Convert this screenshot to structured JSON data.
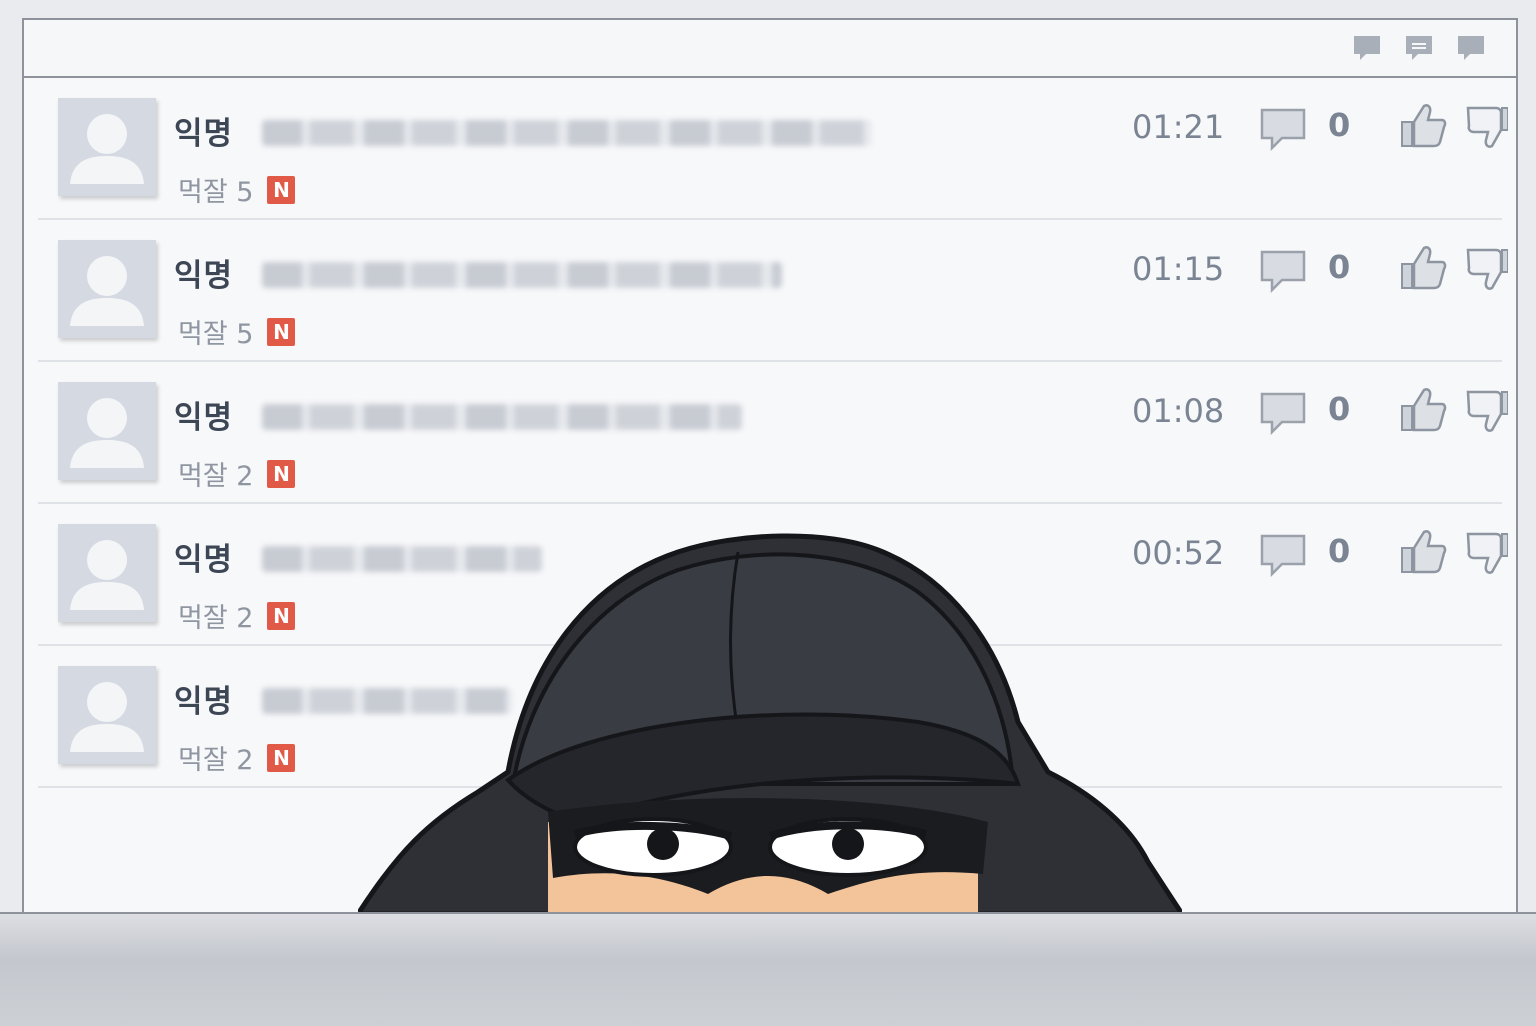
{
  "toolbar": {
    "icons": [
      "comment-icon",
      "expand-icon",
      "comment-icon"
    ]
  },
  "posts": [
    {
      "author": "익명",
      "category": "먹잘",
      "count": "5",
      "badge": "N",
      "time": "01:21",
      "comments": "0",
      "title_width": 610
    },
    {
      "author": "익명",
      "category": "먹잘",
      "count": "5",
      "badge": "N",
      "time": "01:15",
      "comments": "0",
      "title_width": 520
    },
    {
      "author": "익명",
      "category": "먹잘",
      "count": "2",
      "badge": "N",
      "time": "01:08",
      "comments": "0",
      "title_width": 480
    },
    {
      "author": "익명",
      "category": "먹잘",
      "count": "2",
      "badge": "N",
      "time": "00:52",
      "comments": "0",
      "title_width": 280
    },
    {
      "author": "익명",
      "category": "먹잘",
      "count": "2",
      "badge": "N",
      "time": "",
      "comments": "",
      "title_width": 250
    }
  ],
  "colors": {
    "badge": "#e05a47",
    "text": "#3d4654",
    "muted": "#8f96a1",
    "avatar_bg": "#d4d9e2"
  }
}
